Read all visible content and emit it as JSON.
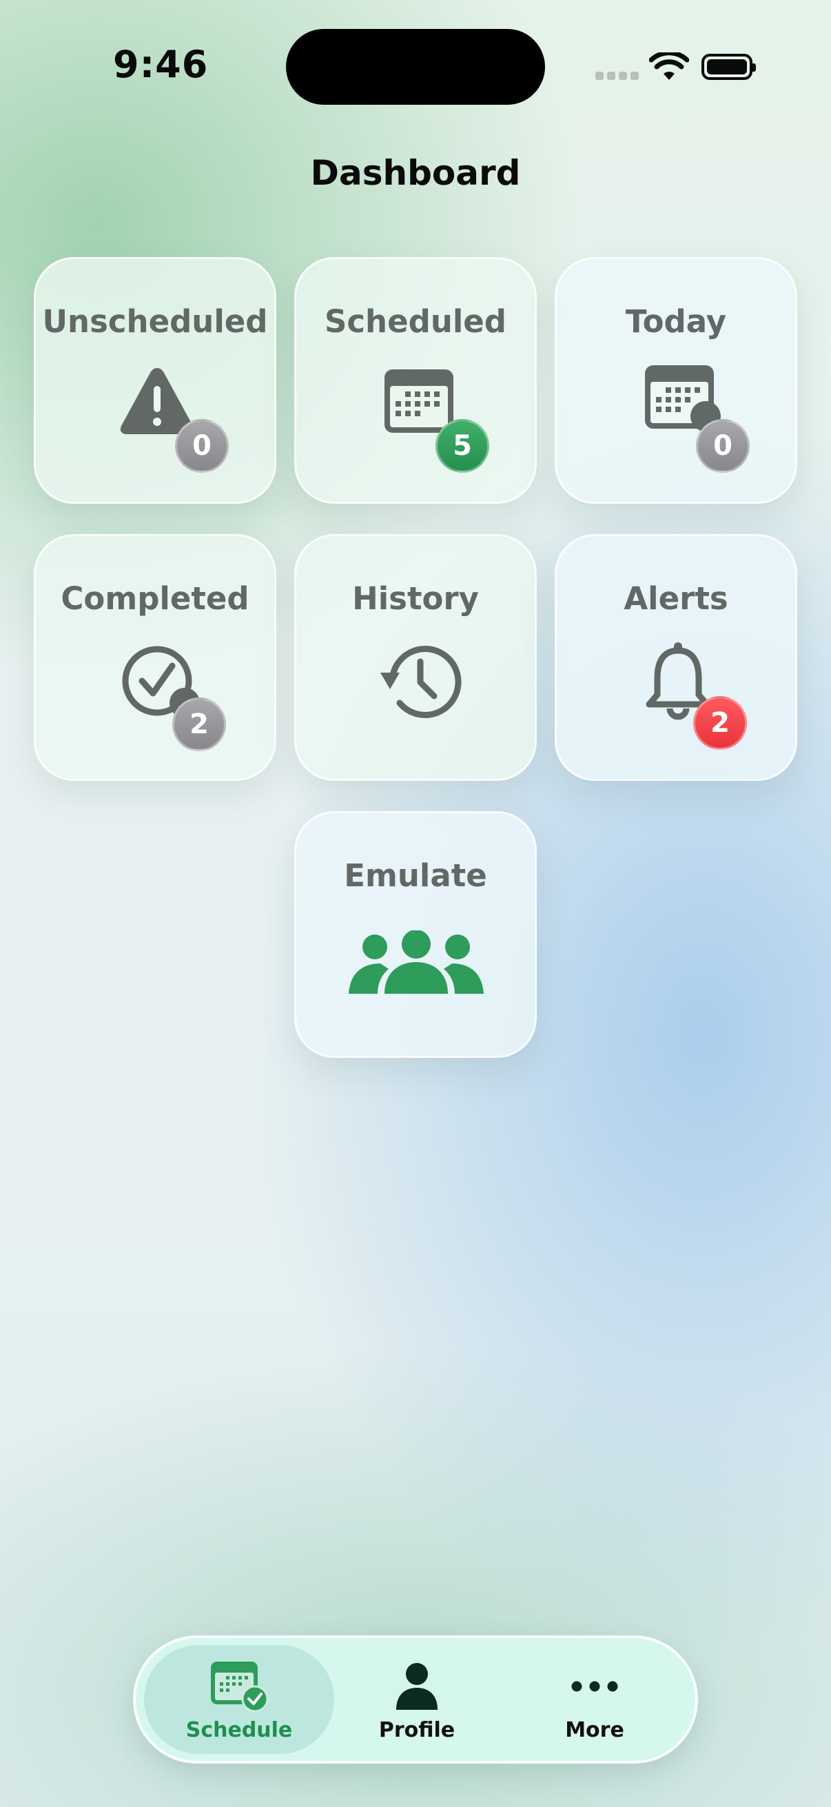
{
  "status_bar": {
    "time": "9:46"
  },
  "header": {
    "title": "Dashboard"
  },
  "tiles": [
    {
      "label": "Unscheduled",
      "icon": "warning-triangle-icon",
      "badge": "0",
      "badge_color": "#98979b"
    },
    {
      "label": "Scheduled",
      "icon": "calendar-icon",
      "badge": "5",
      "badge_color": "#2f9d58"
    },
    {
      "label": "Today",
      "icon": "calendar-clock-icon",
      "badge": "0",
      "badge_color": "#98979b"
    },
    {
      "label": "Completed",
      "icon": "check-circle-icon",
      "badge": "2",
      "badge_color": "#98979b"
    },
    {
      "label": "History",
      "icon": "history-clock-icon"
    },
    {
      "label": "Alerts",
      "icon": "bell-icon",
      "badge": "2",
      "badge_color": "#f1424a"
    },
    {
      "label": "Emulate",
      "icon": "people-group-icon"
    }
  ],
  "tabbar": {
    "items": [
      {
        "label": "Schedule",
        "icon": "calendar-check-icon",
        "selected": true
      },
      {
        "label": "Profile",
        "icon": "person-icon",
        "selected": false
      },
      {
        "label": "More",
        "icon": "ellipsis-icon",
        "selected": false
      }
    ]
  },
  "colors": {
    "accent_green": "#2e9c5a",
    "icon_gray": "#616865",
    "label_gray": "#616865",
    "alert_red": "#f1424a"
  }
}
